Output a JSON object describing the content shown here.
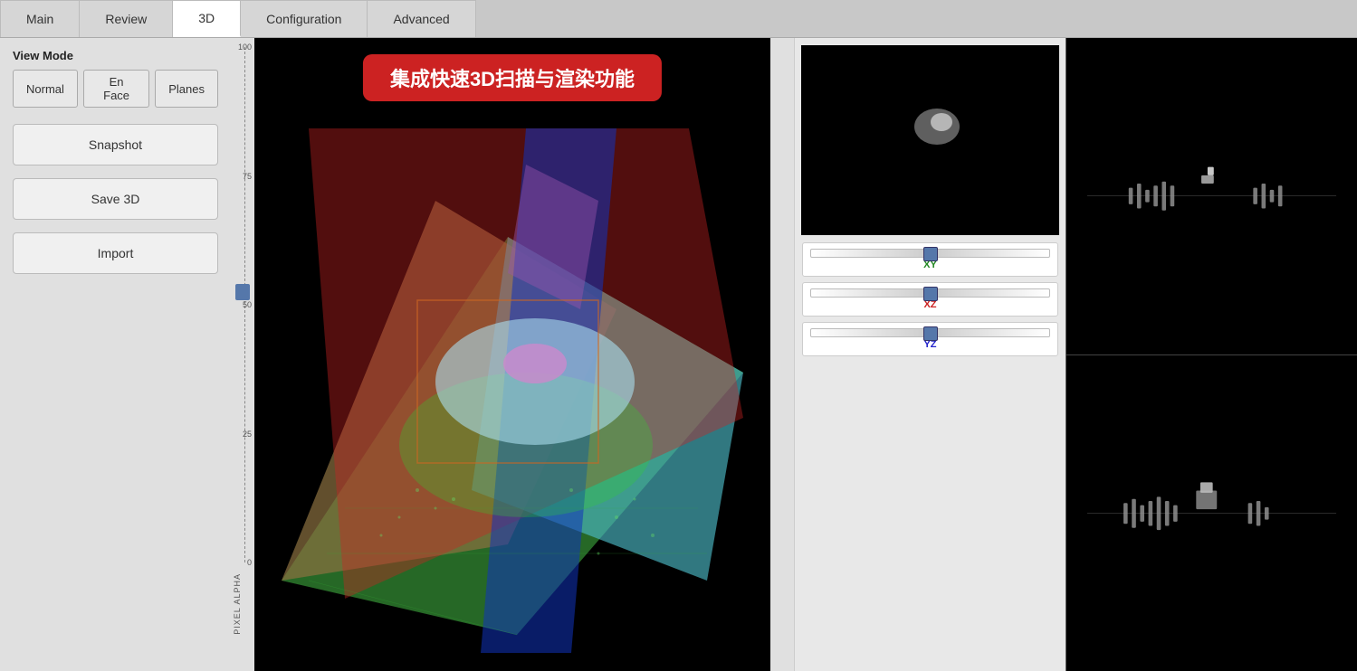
{
  "tabs": [
    {
      "id": "main",
      "label": "Main",
      "active": false
    },
    {
      "id": "review",
      "label": "Review",
      "active": false
    },
    {
      "id": "3d",
      "label": "3D",
      "active": true
    },
    {
      "id": "configuration",
      "label": "Configuration",
      "active": false
    },
    {
      "id": "advanced",
      "label": "Advanced",
      "active": false
    }
  ],
  "view_mode": {
    "label": "View Mode",
    "buttons": [
      {
        "id": "normal",
        "label": "Normal"
      },
      {
        "id": "en_face",
        "label": "En Face"
      },
      {
        "id": "planes",
        "label": "Planes"
      }
    ]
  },
  "actions": {
    "snapshot": "Snapshot",
    "save_3d": "Save 3D",
    "import": "Import"
  },
  "banner": "集成快速3D扫描与渲染功能",
  "alpha_label": "PIXEL ALPHA",
  "ruler": {
    "ticks": [
      "100",
      "75",
      "50",
      "25",
      "0"
    ]
  },
  "sliders": [
    {
      "id": "xy",
      "label": "XY",
      "color_class": "xy"
    },
    {
      "id": "xz",
      "label": "XZ",
      "color_class": "xz"
    },
    {
      "id": "yz",
      "label": "YZ",
      "color_class": "yz"
    }
  ]
}
